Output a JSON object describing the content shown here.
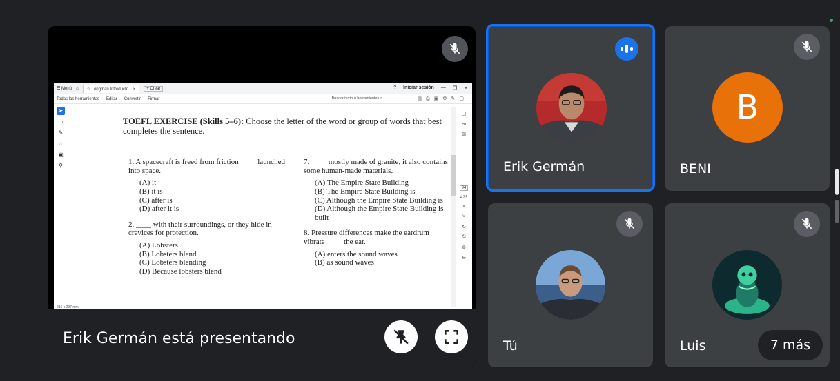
{
  "presentation": {
    "presenter_text": "Erik Germán está presentando",
    "pdf": {
      "menu_label": "☰ Menú",
      "tab_title": "Longman Introducto...",
      "tab_close": "×",
      "new_tab": "+ Crear",
      "signin": "Iniciar sesión",
      "toolbar_items": [
        "Todas las herramientas",
        "Editar",
        "Convertir",
        "Firmar"
      ],
      "search_placeholder": "Buscar texto o herramientas",
      "page_number": "94",
      "page_total": "423",
      "page_size": "216 x 297 mm",
      "heading_bold": "TOEFL EXERCISE (Skills 5–6):",
      "heading_rest": " Choose the letter of the word or group of words that best completes the sentence.",
      "left_column": [
        {
          "q": "1. A spacecraft is freed from friction ____ launched into space.",
          "options": [
            "(A) it",
            "(B) it is",
            "(C) after is",
            "(D) after it is"
          ]
        },
        {
          "q": "2. ____ with their surroundings, or they hide in crevices for protection.",
          "options": [
            "(A) Lobsters",
            "(B) Lobsters blend",
            "(C) Lobsters blending",
            "(D) Because lobsters blend"
          ]
        }
      ],
      "right_column": [
        {
          "q": "7. ____ mostly made of granite, it also contains some human-made materials.",
          "options": [
            "(A) The Empire State Building",
            "(B) The Empire State Building is",
            "(C) Although the Empire State Building is",
            "(D) Although the Empire State Building is built"
          ]
        },
        {
          "q": "8. Pressure differences make the eardrum vibrate ____ the ear.",
          "options": [
            "(A) enters the sound waves",
            "(B) as sound waves"
          ]
        }
      ]
    }
  },
  "participants": {
    "erik": {
      "name": "Erik Germán"
    },
    "beni": {
      "name": "BENI",
      "initial": "B",
      "color": "#e8710a"
    },
    "tu": {
      "name": "Tú"
    },
    "luis": {
      "name": "Luis"
    },
    "more": {
      "label": "7 más"
    }
  },
  "icons": [
    "mic-off-icon",
    "speaking-indicator-icon",
    "stop-presenting-icon",
    "fullscreen-icon"
  ]
}
